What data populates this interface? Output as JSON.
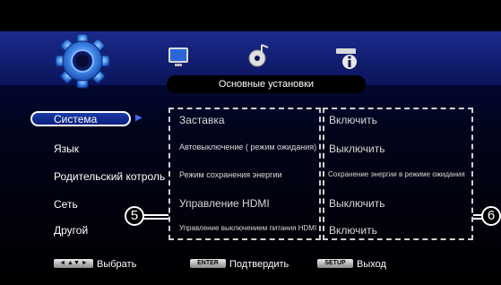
{
  "colors": {
    "accent": "#1a3aa8",
    "background": "#000000",
    "header": "#1c2a8c"
  },
  "icons": [
    "gear-icon",
    "tv-icon",
    "music-disc-icon",
    "player-info-icon"
  ],
  "section_title": "Основные установки",
  "menu": {
    "items": [
      "Система",
      "Язык",
      "Родительский котроль",
      "Сеть",
      "Другой"
    ],
    "selected_index": 0
  },
  "settings": [
    {
      "name": "Заставка",
      "value": "Включить"
    },
    {
      "name": "Автовыключение ( режим ожидания)",
      "value": "Выключить"
    },
    {
      "name": "Режим сохранения энергии",
      "value": "Сохранение энергии в режиме ожидания"
    },
    {
      "name": "Управление HDMI",
      "value": "Выключить"
    },
    {
      "name": "Управление выключением питания HDMI",
      "value": "Включить"
    }
  ],
  "callouts": {
    "left": "5",
    "right": "6"
  },
  "footer": {
    "select_key": "◄ ▲▼ ►",
    "select_label": "Выбрать",
    "enter_key": "ENTER",
    "enter_label": "Подтвердить",
    "setup_key": "SETUP",
    "setup_label": "Выход"
  }
}
